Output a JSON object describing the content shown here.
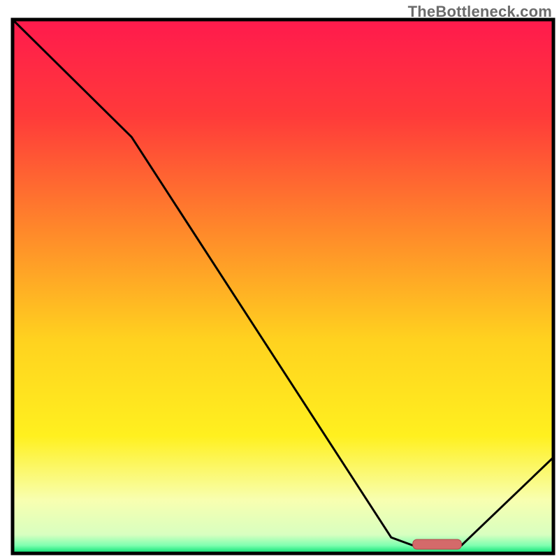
{
  "watermark": "TheBottleneck.com",
  "chart_data": {
    "type": "line",
    "title": "",
    "xlabel": "",
    "ylabel": "",
    "xlim": [
      0,
      100
    ],
    "ylim": [
      0,
      100
    ],
    "curve": [
      {
        "x": 0,
        "y": 100
      },
      {
        "x": 22,
        "y": 78
      },
      {
        "x": 70,
        "y": 3
      },
      {
        "x": 74,
        "y": 1.5
      },
      {
        "x": 83,
        "y": 1.5
      },
      {
        "x": 100,
        "y": 18
      }
    ],
    "optimal_band": {
      "x_start": 74,
      "x_end": 83,
      "y": 1.7
    },
    "gradient_stops": [
      {
        "offset": 0.0,
        "color": "#ff1a4d"
      },
      {
        "offset": 0.18,
        "color": "#ff3a3a"
      },
      {
        "offset": 0.4,
        "color": "#ff8a2a"
      },
      {
        "offset": 0.6,
        "color": "#ffd21f"
      },
      {
        "offset": 0.78,
        "color": "#fff01f"
      },
      {
        "offset": 0.9,
        "color": "#f8ffb0"
      },
      {
        "offset": 0.965,
        "color": "#d8ffc0"
      },
      {
        "offset": 0.985,
        "color": "#7fffb0"
      },
      {
        "offset": 1.0,
        "color": "#00e070"
      }
    ],
    "outer_border_color": "#000000",
    "curve_color": "#000000",
    "band_fill": "#d46a6a",
    "band_stroke": "#b04a4a"
  }
}
